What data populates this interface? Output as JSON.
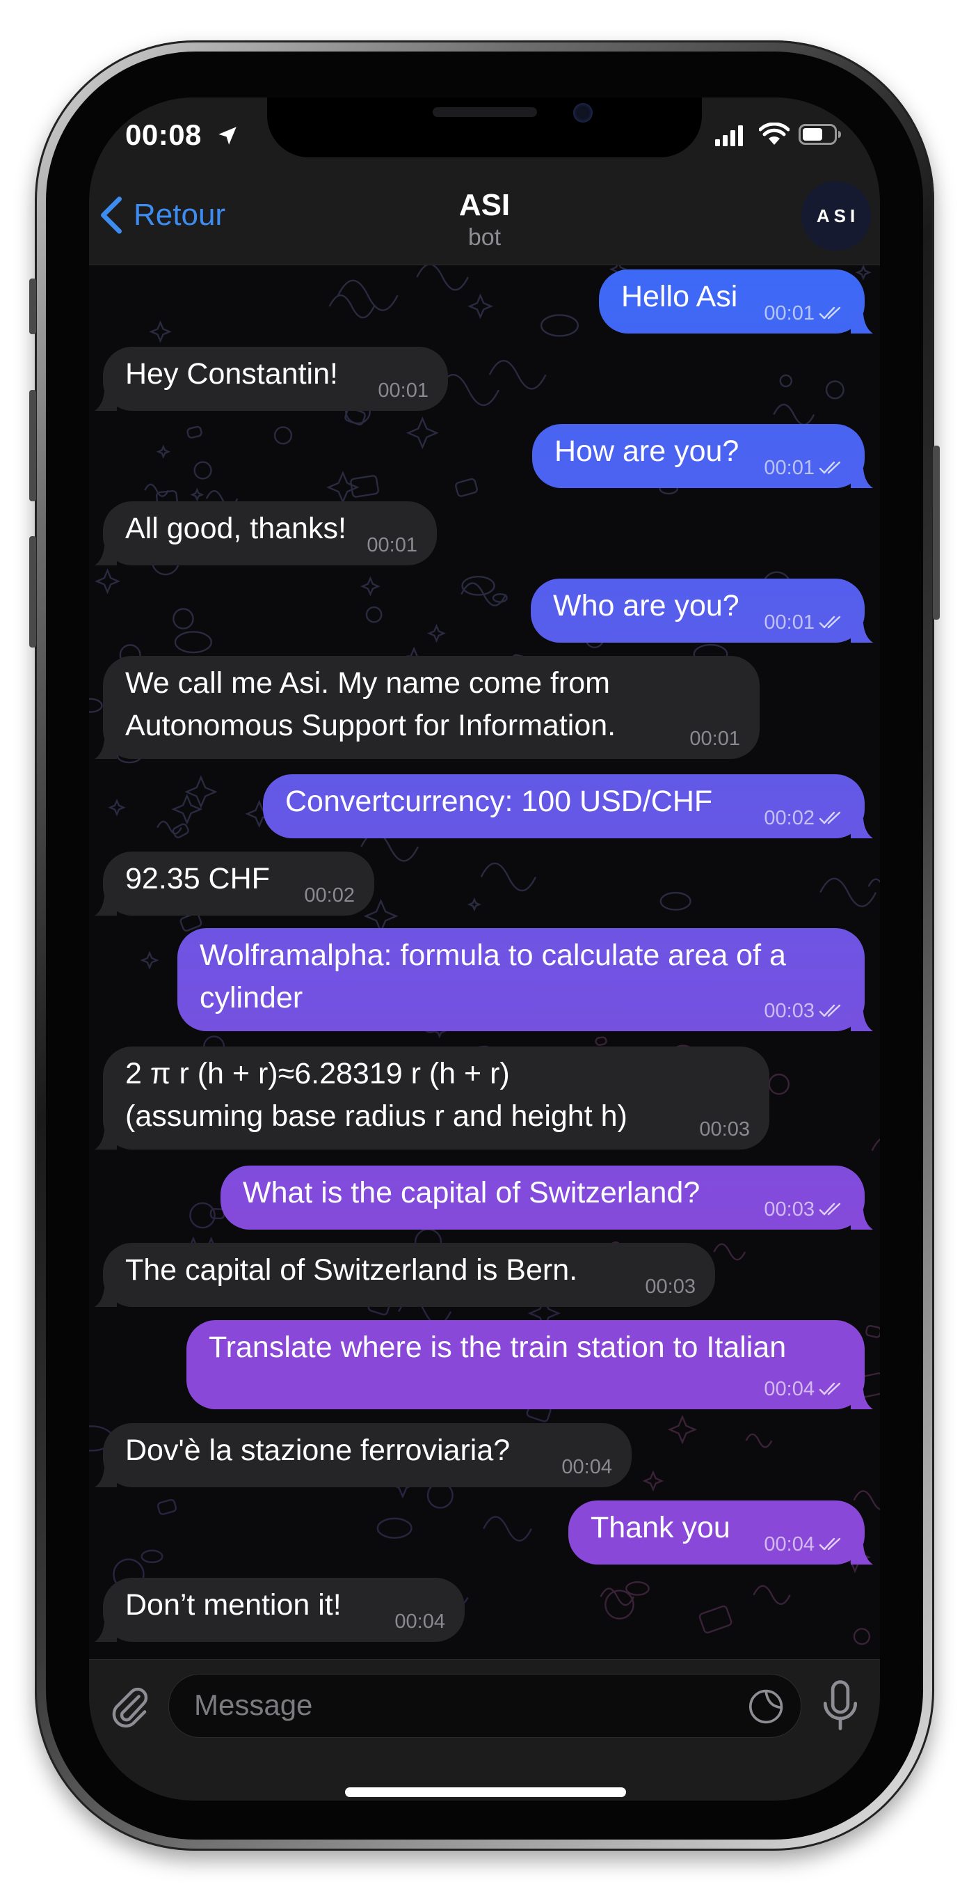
{
  "status_bar": {
    "time": "00:08"
  },
  "header": {
    "back_label": "Retour",
    "title": "ASI",
    "subtitle": "bot",
    "avatar_text": "ASI"
  },
  "theme": {
    "accent": "#3e8cf0",
    "incoming_bubble": "#252528",
    "outgoing_gradient_top": "#3c69f6",
    "outgoing_gradient_bottom": "#8a48d8"
  },
  "messages": [
    {
      "side": "out",
      "text": "Hello Asi",
      "time": "00:01",
      "read": true
    },
    {
      "side": "in",
      "text": "Hey Constantin!",
      "time": "00:01"
    },
    {
      "side": "out",
      "text": "How are you?",
      "time": "00:01",
      "read": true
    },
    {
      "side": "in",
      "text": "All good, thanks!",
      "time": "00:01"
    },
    {
      "side": "out",
      "text": "Who are you?",
      "time": "00:01",
      "read": true
    },
    {
      "side": "in",
      "text": "We call me Asi. My name come from\nAutonomous Support for Information.",
      "time": "00:01"
    },
    {
      "side": "out",
      "text": "Convertcurrency: 100 USD/CHF",
      "time": "00:02",
      "read": true
    },
    {
      "side": "in",
      "text": "92.35 CHF",
      "time": "00:02"
    },
    {
      "side": "out",
      "text": "Wolframalpha: formula to calculate area of a\ncylinder",
      "time": "00:03",
      "read": true
    },
    {
      "side": "in",
      "text": "2 π r (h + r)≈6.28319 r (h + r)\n(assuming base radius r and height h)",
      "time": "00:03"
    },
    {
      "side": "out",
      "text": "What is the capital of Switzerland?",
      "time": "00:03",
      "read": true
    },
    {
      "side": "in",
      "text": "The capital of Switzerland is Bern.",
      "time": "00:03"
    },
    {
      "side": "out",
      "text": "Translate where is the train station to Italian",
      "time": "00:04",
      "read": true
    },
    {
      "side": "in",
      "text": "Dov'è la stazione ferroviaria?",
      "time": "00:04"
    },
    {
      "side": "out",
      "text": "Thank you",
      "time": "00:04",
      "read": true
    },
    {
      "side": "in",
      "text": "Don’t mention it!",
      "time": "00:04"
    }
  ],
  "input": {
    "placeholder": "Message"
  }
}
